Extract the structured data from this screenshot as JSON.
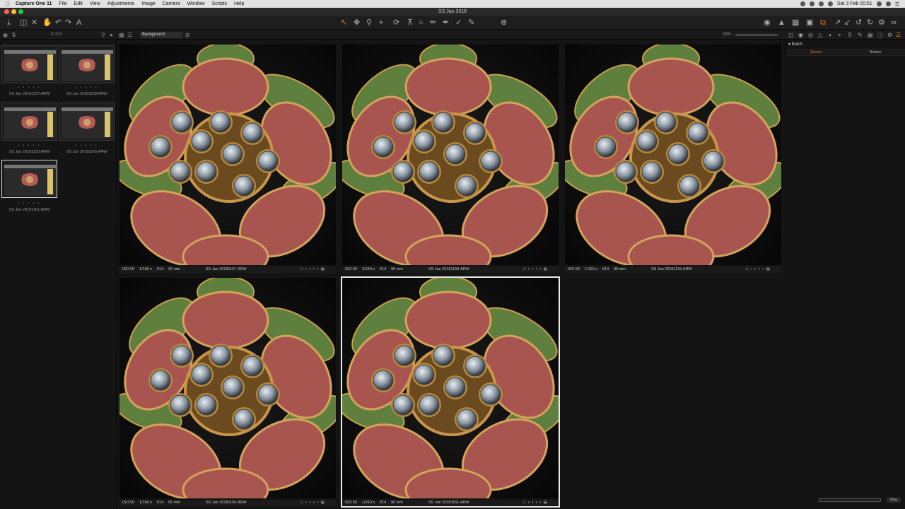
{
  "menubar": {
    "app_name": "Capture One 11",
    "items": [
      "File",
      "Edit",
      "View",
      "Adjustments",
      "Image",
      "Camera",
      "Window",
      "Scripts",
      "Help"
    ],
    "clock": "Sat 3 Feb  00:51"
  },
  "window": {
    "title": "SS Jan 2018"
  },
  "subbar": {
    "count": "5 of 5",
    "collection": "Background",
    "zoom": "33%"
  },
  "thumbnails": [
    {
      "name": "SS Jan 20181157.ARW",
      "selected": false
    },
    {
      "name": "SS Jan 20181158.ARW",
      "selected": false
    },
    {
      "name": "SS Jan 20181159.ARW",
      "selected": false
    },
    {
      "name": "SS Jan 20181160.ARW",
      "selected": false
    },
    {
      "name": "SS Jan 20181161.ARW",
      "selected": true
    }
  ],
  "viewer": [
    {
      "iso": "ISO 50",
      "shutter": "1/160 s",
      "aperture": "f/14",
      "focal": "90 mm",
      "name": "SS Jan 20181157.ARW",
      "selected": false
    },
    {
      "iso": "ISO 50",
      "shutter": "1/160 s",
      "aperture": "f/14",
      "focal": "90 mm",
      "name": "SS Jan 20181158.ARW",
      "selected": false
    },
    {
      "iso": "ISO 50",
      "shutter": "1/160 s",
      "aperture": "f/14",
      "focal": "90 mm",
      "name": "SS Jan 20181159.ARW",
      "selected": false
    },
    {
      "iso": "ISO 50",
      "shutter": "1/160 s",
      "aperture": "f/14",
      "focal": "90 mm",
      "name": "SS Jan 20181160.ARW",
      "selected": false
    },
    {
      "iso": "ISO 50",
      "shutter": "1/160 s",
      "aperture": "f/14",
      "focal": "90 mm",
      "name": "SS Jan 20181161.ARW",
      "selected": true
    }
  ],
  "right_panel": {
    "section": "Batch",
    "tabs": [
      "Queue",
      "History"
    ],
    "active_tab": "Queue",
    "stop_label": "Stop"
  },
  "colors": {
    "accent": "#e7731e",
    "background": "#141414"
  }
}
